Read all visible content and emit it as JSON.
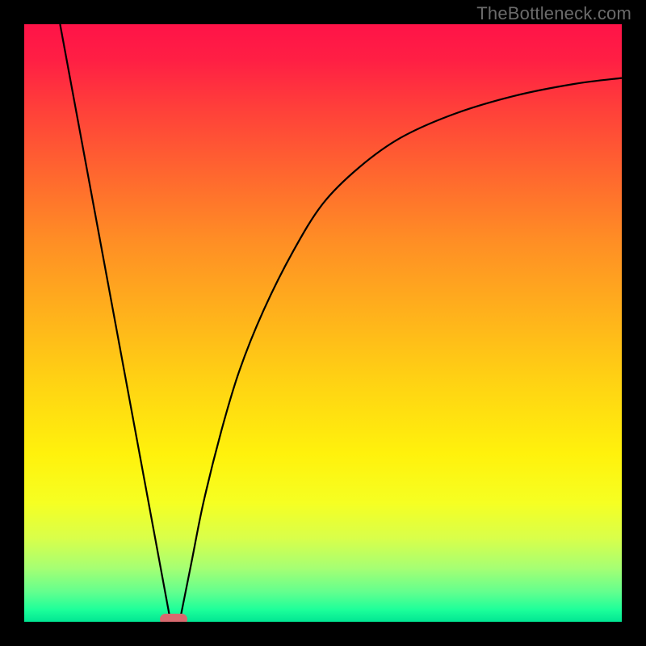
{
  "watermark": "TheBottleneck.com",
  "chart_data": {
    "type": "line",
    "title": "",
    "xlabel": "",
    "ylabel": "",
    "xlim": [
      0,
      100
    ],
    "ylim": [
      0,
      100
    ],
    "grid": false,
    "legend": false,
    "series": [
      {
        "name": "left-segment",
        "kind": "line",
        "x": [
          6,
          24.5
        ],
        "y": [
          100,
          0
        ]
      },
      {
        "name": "right-curve",
        "kind": "curve",
        "x": [
          26,
          28,
          30,
          33,
          36,
          40,
          45,
          50,
          56,
          63,
          72,
          82,
          92,
          100
        ],
        "y": [
          0,
          10,
          20,
          32,
          42,
          52,
          62,
          70,
          76,
          81,
          85,
          88,
          90,
          91
        ]
      }
    ],
    "marker": {
      "x": 25,
      "y": 0,
      "shape": "rounded-rect",
      "color": "#d86a6f"
    },
    "background_gradient": {
      "direction": "vertical",
      "stops": [
        {
          "pos": 0.0,
          "color": "#ff1348"
        },
        {
          "pos": 0.5,
          "color": "#ffb01c"
        },
        {
          "pos": 0.8,
          "color": "#f6ff22"
        },
        {
          "pos": 1.0,
          "color": "#00e693"
        }
      ]
    }
  }
}
